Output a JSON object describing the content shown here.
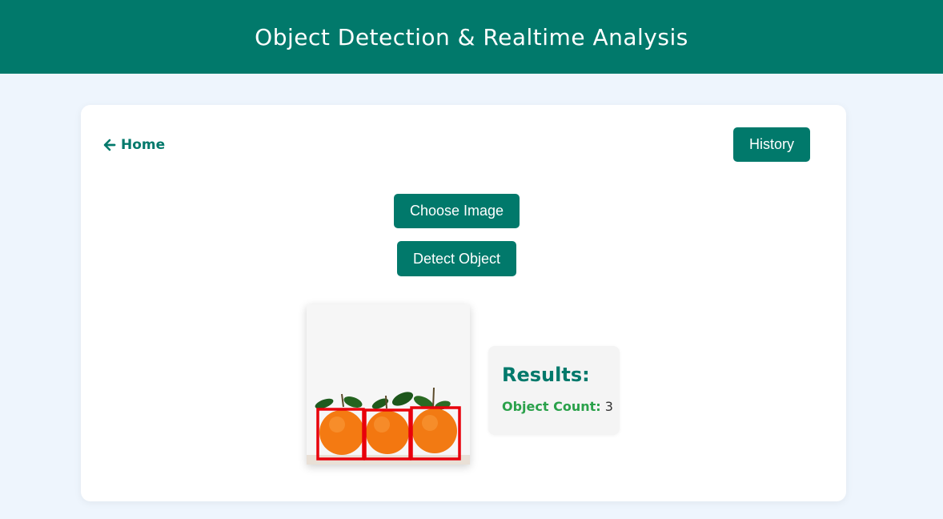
{
  "header": {
    "title": "Object Detection & Realtime Analysis"
  },
  "nav": {
    "home_label": "Home",
    "home_icon": "arrow-left-icon"
  },
  "actions": {
    "history_label": "History",
    "choose_image_label": "Choose Image",
    "detect_object_label": "Detect Object"
  },
  "results": {
    "title": "Results:",
    "object_count_label": "Object Count:",
    "object_count_value": "3"
  },
  "detection": {
    "detected_objects": 3,
    "subject": "oranges",
    "box_color": "#e8000b"
  },
  "colors": {
    "primary": "#01796b",
    "background": "#eef5fd",
    "count_label": "#2aa14a"
  }
}
